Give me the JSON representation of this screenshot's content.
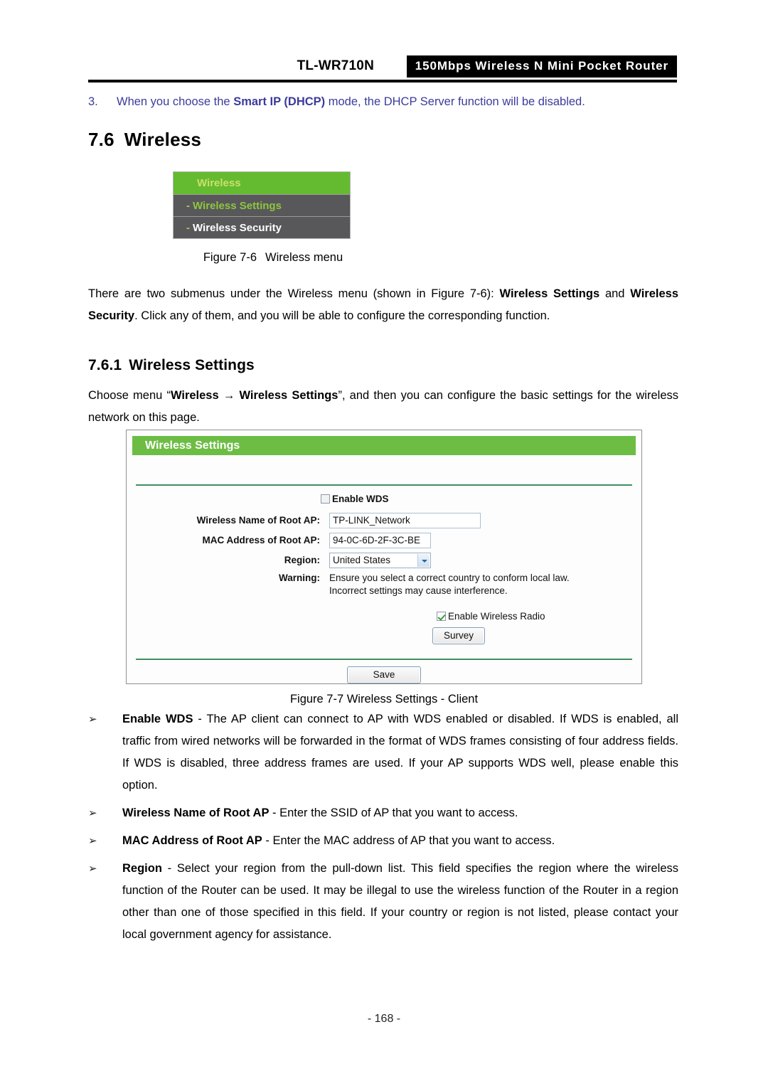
{
  "header": {
    "model": "TL-WR710N",
    "product_band": "150Mbps Wireless N Mini Pocket Router"
  },
  "note": {
    "number": "3.",
    "text_before": "When you choose the ",
    "bold_1": "Smart IP (DHCP)",
    "text_after": " mode, the DHCP Server function will be disabled."
  },
  "section": {
    "number": "7.6",
    "title": "Wireless"
  },
  "subsection": {
    "number": "7.6.1",
    "title": "Wireless Settings"
  },
  "menu_figure": {
    "parent_label": "Wireless",
    "dash": "-",
    "items": [
      {
        "label": "Wireless Settings",
        "style": "green"
      },
      {
        "label": "Wireless Security",
        "style": "white"
      }
    ]
  },
  "captions": {
    "figure_76_label": "Figure 7-6",
    "figure_76_title": "Wireless menu",
    "figure_77": "Figure 7-7 Wireless Settings - Client"
  },
  "paragraphs": {
    "intro_a": "There are two submenus under the Wireless menu (shown in Figure 7-6): ",
    "intro_b": "Wireless Settings",
    "intro_c": " and ",
    "intro_d": "Wireless Security",
    "intro_e": ". Click any of them, and you will be able to configure the corresponding function.",
    "choose_a": "Choose menu “",
    "choose_b": "Wireless",
    "choose_arrow": "→",
    "choose_c": "Wireless Settings",
    "choose_d": "”, and then you can configure the basic settings for the wireless network on this page."
  },
  "wireless_settings_panel": {
    "title": "Wireless Settings",
    "enable_wds": {
      "label": "Enable WDS",
      "checked": false
    },
    "fields": [
      {
        "label": "Wireless Name of Root AP:",
        "value": "TP-LINK_Network"
      },
      {
        "label": "MAC Address of Root AP:",
        "value": "94-0C-6D-2F-3C-BE"
      }
    ],
    "region": {
      "label": "Region:",
      "value": "United States"
    },
    "warning": {
      "label": "Warning:",
      "line1": "Ensure you select a correct country to conform local law.",
      "line2": "Incorrect settings may cause interference."
    },
    "enable_wireless_radio": {
      "label": "Enable Wireless Radio",
      "checked": true
    },
    "survey_button": "Survey",
    "save_button": "Save",
    "colors": {
      "header_green": "#6dbd45",
      "divider_green": "#3f8f63",
      "input_border": "#aebfd0"
    }
  },
  "bullets": [
    {
      "marker": "➢",
      "term": "Enable WDS",
      "rest": " - The AP client can connect to AP with WDS enabled or disabled. If WDS is enabled, all traffic from wired networks will be forwarded in the format of WDS frames consisting of four address fields. If WDS is disabled, three address frames are used. If your AP supports WDS well, please enable this option."
    },
    {
      "marker": "➢",
      "term": "Wireless Name of Root AP",
      "rest": " - Enter the SSID of AP that you want to access."
    },
    {
      "marker": "➢",
      "term": "MAC Address of Root AP",
      "rest": " - Enter the MAC address of AP that you want to access."
    },
    {
      "marker": "➢",
      "term": "Region",
      "rest": " - Select your region from the pull-down list. This field specifies the region where the wireless function of the Router can be used. It may be illegal to use the wireless function of the Router in a region other than one of those specified in this field. If your country or region is not listed, please contact your local government agency for assistance."
    }
  ],
  "footer": {
    "page_number": "- 168 -"
  }
}
